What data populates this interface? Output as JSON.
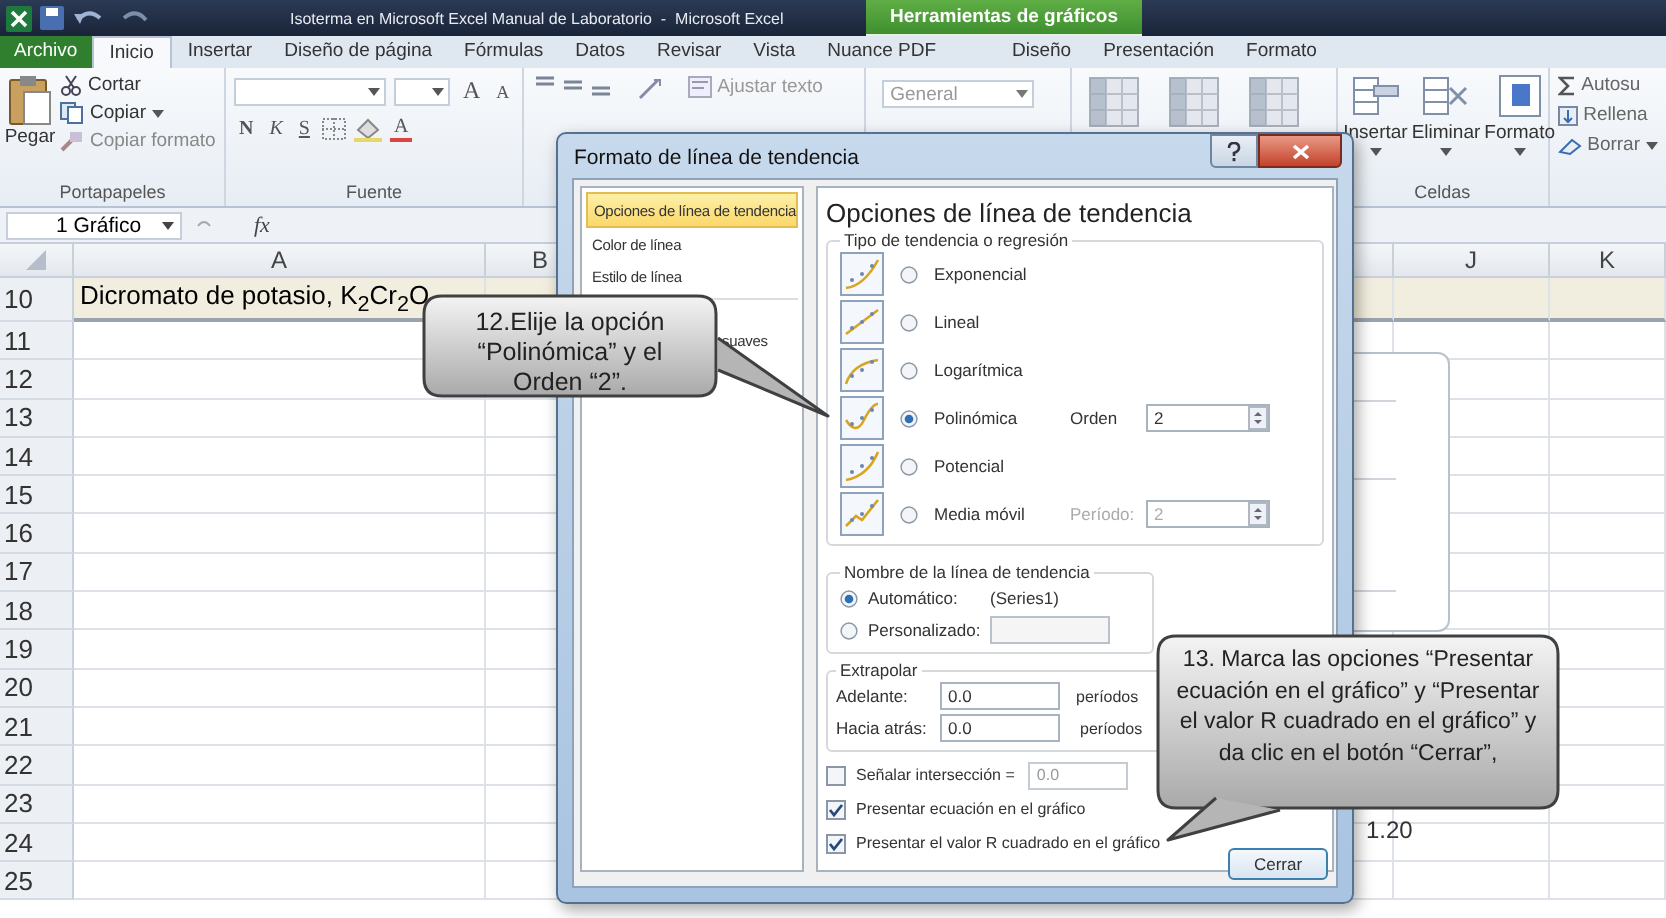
{
  "window": {
    "title": "Isoterma en Microsoft Excel Manual de Laboratorio  -  Microsoft Excel",
    "contextual_group": "Herramientas de gráficos"
  },
  "tabs": [
    {
      "label": "Archivo",
      "kind": "file",
      "selected": false
    },
    {
      "label": "Inicio",
      "kind": "tab",
      "selected": true
    },
    {
      "label": "Insertar",
      "kind": "tab",
      "selected": false
    },
    {
      "label": "Diseño de página",
      "kind": "tab",
      "selected": false
    },
    {
      "label": "Fórmulas",
      "kind": "tab",
      "selected": false
    },
    {
      "label": "Datos",
      "kind": "tab",
      "selected": false
    },
    {
      "label": "Revisar",
      "kind": "tab",
      "selected": false
    },
    {
      "label": "Vista",
      "kind": "tab",
      "selected": false
    },
    {
      "label": "Nuance PDF",
      "kind": "tab",
      "selected": false
    },
    {
      "label": "Diseño",
      "kind": "context",
      "selected": false
    },
    {
      "label": "Presentación",
      "kind": "context",
      "selected": false
    },
    {
      "label": "Formato",
      "kind": "context",
      "selected": false
    }
  ],
  "ribbon": {
    "clipboard": {
      "paste": "Pegar",
      "cut": "Cortar",
      "copy": "Copiar",
      "format_painter": "Copiar formato",
      "label": "Portapapeles"
    },
    "font": {
      "grow": "A",
      "shrink": "A",
      "bold": "N",
      "italic": "K",
      "underline": "S",
      "font_color": "A",
      "label": "Fuente"
    },
    "alignment": {
      "wrap_text": "Ajustar texto"
    },
    "number": {
      "format": "General"
    },
    "cells": {
      "buttons": [
        "Insertar",
        "Eliminar",
        "Formato"
      ],
      "label": "Celdas"
    },
    "editing": {
      "items": [
        "Autosu",
        "Rellena",
        "Borrar"
      ]
    }
  },
  "formula_bar": {
    "name_box": "1 Gráfico",
    "function_label": "fx"
  },
  "sheet": {
    "columns": [
      "A",
      "B",
      "J",
      "K"
    ],
    "rows": [
      {
        "number": "10",
        "cell": "Dicromato de potasio, K$_{2}$Cr$_{2}$O"
      },
      {
        "number": "11"
      },
      {
        "number": "12"
      },
      {
        "number": "13"
      },
      {
        "number": "14"
      },
      {
        "number": "15"
      },
      {
        "number": "16"
      },
      {
        "number": "17"
      },
      {
        "number": "18"
      },
      {
        "number": "19"
      },
      {
        "number": "20"
      },
      {
        "number": "21"
      },
      {
        "number": "22"
      },
      {
        "number": "23"
      },
      {
        "number": "24"
      },
      {
        "number": "25"
      }
    ]
  },
  "chart": {
    "axis_label": "1.20"
  },
  "dialog": {
    "title": "Formato de línea de tendencia",
    "nav": [
      {
        "label": "Opciones de línea de tendencia",
        "selected": true
      },
      {
        "label": "Color de línea",
        "selected": false
      },
      {
        "label": "Estilo de línea",
        "selected": false
      },
      {
        "label": "suaves",
        "selected": false
      }
    ],
    "heading": "Opciones de línea de tendencia",
    "type_group": {
      "legend": "Tipo de tendencia o regresión",
      "options": [
        {
          "label": "Exponencial",
          "selected": false
        },
        {
          "label": "Lineal",
          "selected": false
        },
        {
          "label": "Logarítmica",
          "selected": false
        },
        {
          "label": "Polinómica",
          "selected": true,
          "param_label": "Orden",
          "param_value": "2",
          "param_disabled": false
        },
        {
          "label": "Potencial",
          "selected": false
        },
        {
          "label": "Media móvil",
          "selected": false,
          "param_label": "Período:",
          "param_value": "2",
          "param_disabled": true
        }
      ]
    },
    "name_group": {
      "legend": "Nombre de la línea de tendencia",
      "options": [
        {
          "label": "Automático:",
          "selected": true,
          "kind": "text",
          "value": "(Series1)"
        },
        {
          "label": "Personalizado:",
          "selected": false,
          "kind": "field"
        }
      ]
    },
    "extrapolate": {
      "legend": "Extrapolar",
      "rows": [
        {
          "label": "Adelante:",
          "value": "0.0",
          "unit": "períodos"
        },
        {
          "label": "Hacia atrás:",
          "value": "0.0",
          "unit": "períodos"
        }
      ]
    },
    "checks": [
      {
        "label": "Señalar intersección =",
        "checked": false,
        "value": "0.0"
      },
      {
        "label": "Presentar ecuación en el gráfico",
        "checked": true
      },
      {
        "label": "Presentar el valor R cuadrado en el gráfico",
        "checked": true
      }
    ],
    "close_button": "Cerrar"
  },
  "callouts": [
    {
      "text": "12.Elije la opción “Polinómica” y el Orden “2”."
    },
    {
      "text": "13. Marca las opciones “Presentar ecuación en el gráfico” y “Presentar el valor R cuadrado en el gráfico” y da clic en el botón “Cerrar”,"
    }
  ]
}
